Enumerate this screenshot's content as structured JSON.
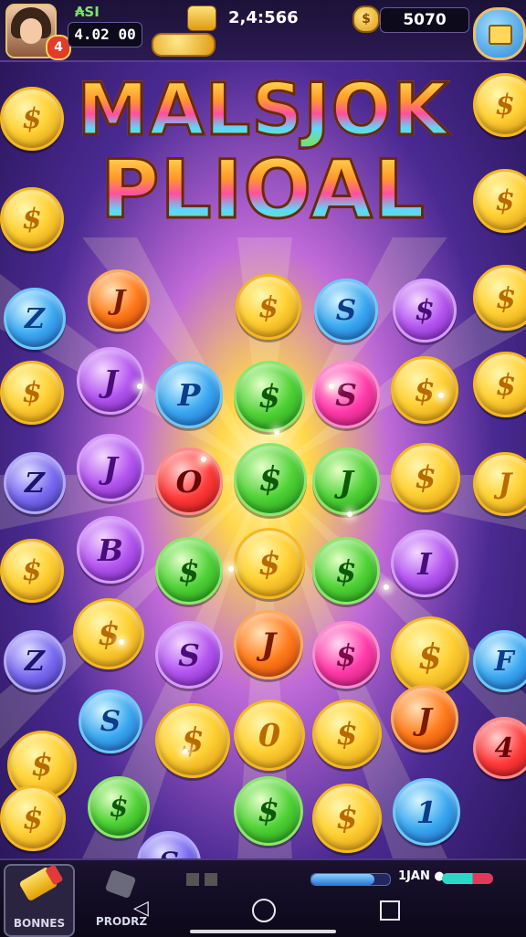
{
  "hud": {
    "plus_label": "₳SІ",
    "level": "4",
    "score": "4.02 00",
    "gold_value": "2,4:566",
    "coin_symbol": "$",
    "coin_value": "5070"
  },
  "title": {
    "line1": "MALSJOK",
    "line2": "PLIOAL"
  },
  "board": {
    "coins": [
      {
        "color": "gold",
        "glyph": "$"
      },
      {
        "color": "blue",
        "glyph": "Z"
      },
      {
        "color": "orange",
        "glyph": "J"
      },
      {
        "color": "gold",
        "glyph": "$"
      },
      {
        "color": "blue",
        "glyph": "S"
      },
      {
        "color": "purple",
        "glyph": "$"
      },
      {
        "color": "gold",
        "glyph": "$"
      },
      {
        "color": "gold",
        "glyph": "$"
      },
      {
        "color": "gold",
        "glyph": "$"
      },
      {
        "color": "purple",
        "glyph": "J"
      },
      {
        "color": "blue",
        "glyph": "P"
      },
      {
        "color": "green",
        "glyph": "$"
      },
      {
        "color": "pink",
        "glyph": "S"
      },
      {
        "color": "gold",
        "glyph": "$"
      },
      {
        "color": "gold",
        "glyph": "$"
      },
      {
        "color": "violet",
        "glyph": "Z"
      },
      {
        "color": "purple",
        "glyph": "J"
      },
      {
        "color": "red",
        "glyph": "O"
      },
      {
        "color": "green",
        "glyph": "$"
      },
      {
        "color": "green",
        "glyph": "J"
      },
      {
        "color": "gold",
        "glyph": "$"
      },
      {
        "color": "gold",
        "glyph": "$"
      },
      {
        "color": "gold",
        "glyph": "$"
      },
      {
        "color": "purple",
        "glyph": "B"
      },
      {
        "color": "green",
        "glyph": "$"
      },
      {
        "color": "gold",
        "glyph": "$"
      },
      {
        "color": "green",
        "glyph": "$"
      },
      {
        "color": "purple",
        "glyph": "I"
      },
      {
        "color": "gold",
        "glyph": "J"
      },
      {
        "color": "violet",
        "glyph": "Z"
      },
      {
        "color": "gold",
        "glyph": "$"
      },
      {
        "color": "purple",
        "glyph": "S"
      },
      {
        "color": "orange",
        "glyph": "J"
      },
      {
        "color": "pink",
        "glyph": "$"
      },
      {
        "color": "gold",
        "glyph": "$"
      },
      {
        "color": "blue",
        "glyph": "F"
      },
      {
        "color": "gold",
        "glyph": "$"
      },
      {
        "color": "blue",
        "glyph": "S"
      },
      {
        "color": "gold",
        "glyph": "$"
      },
      {
        "color": "gold",
        "glyph": "0"
      },
      {
        "color": "gold",
        "glyph": "$"
      },
      {
        "color": "orange",
        "glyph": "J"
      },
      {
        "color": "red",
        "glyph": "4"
      },
      {
        "color": "gold",
        "glyph": "$"
      },
      {
        "color": "gold",
        "glyph": "$"
      },
      {
        "color": "green",
        "glyph": "$"
      },
      {
        "color": "gold",
        "glyph": "$"
      },
      {
        "color": "blue",
        "glyph": "1"
      },
      {
        "color": "green",
        "glyph": "$"
      },
      {
        "color": "violet",
        "glyph": "S"
      }
    ]
  },
  "bottom_bar": {
    "bonus_label": "BONNES",
    "product_label": "PRODRZ",
    "right_label": "1JAN ●",
    "progress_fraction": 0.8
  },
  "icons": {
    "shop": "chest-icon",
    "gold": "gold-bar-icon",
    "coin": "coin-icon",
    "bonus": "rocket-icon",
    "product": "hammer-icon"
  }
}
